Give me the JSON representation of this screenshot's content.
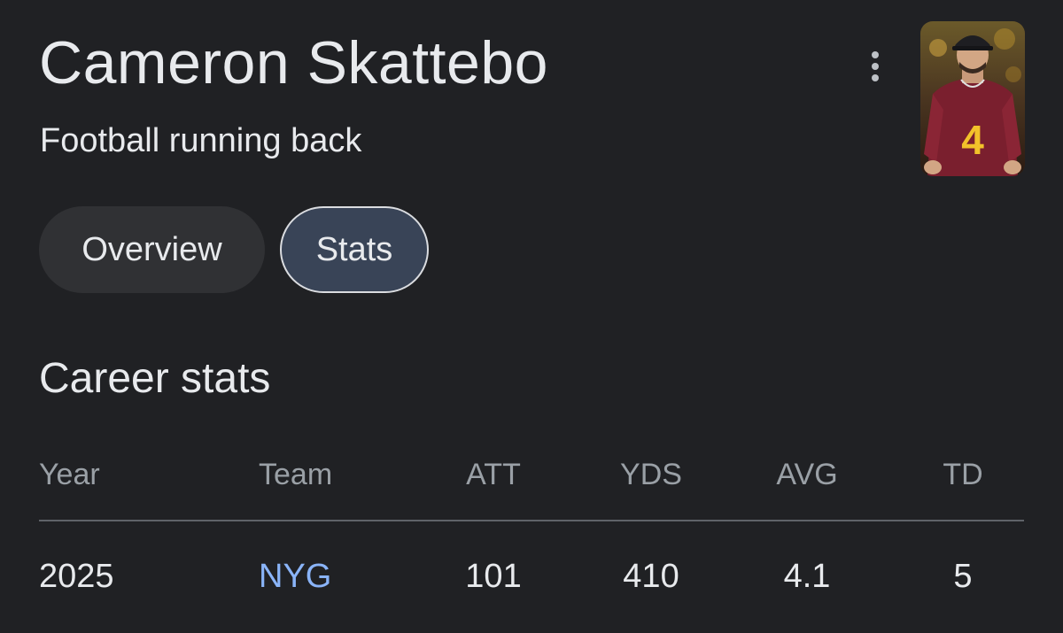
{
  "header": {
    "name": "Cameron Skattebo",
    "description": "Football running back",
    "more_icon": "more-vert-icon",
    "thumbnail_jersey_number": "4"
  },
  "tabs": [
    {
      "label": "Overview",
      "selected": false
    },
    {
      "label": "Stats",
      "selected": true
    }
  ],
  "career_stats": {
    "heading": "Career stats",
    "columns": [
      "Year",
      "Team",
      "ATT",
      "YDS",
      "AVG",
      "TD"
    ],
    "rows": [
      [
        "2025",
        "NYG",
        "101",
        "410",
        "4.1",
        "5"
      ]
    ]
  },
  "colors": {
    "background": "#202124",
    "link": "#8ab4f8",
    "selected_chip": "#394457"
  }
}
